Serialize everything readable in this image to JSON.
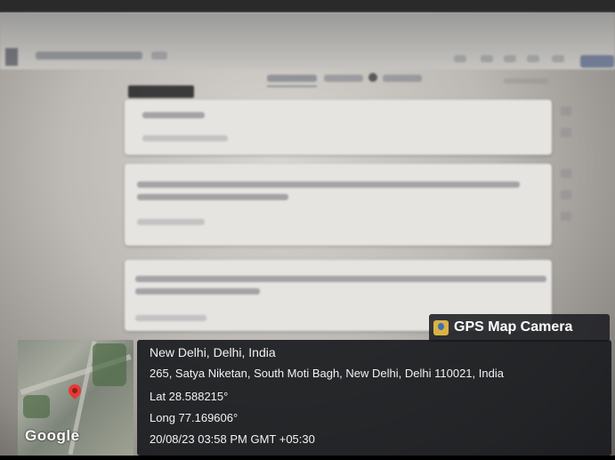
{
  "overlay": {
    "badge_label": "GPS Map Camera",
    "place": "New Delhi, Delhi, India",
    "address": "265, Satya Niketan, South Moti Bagh, New Delhi, Delhi 110021, India",
    "lat": "Lat 28.588215°",
    "long": "Long 77.169606°",
    "datetime": "20/08/23 03:58 PM GMT +05:30",
    "map_logo": "Google"
  },
  "colors": {
    "pin": "#e53935",
    "panel": "#16181c"
  }
}
